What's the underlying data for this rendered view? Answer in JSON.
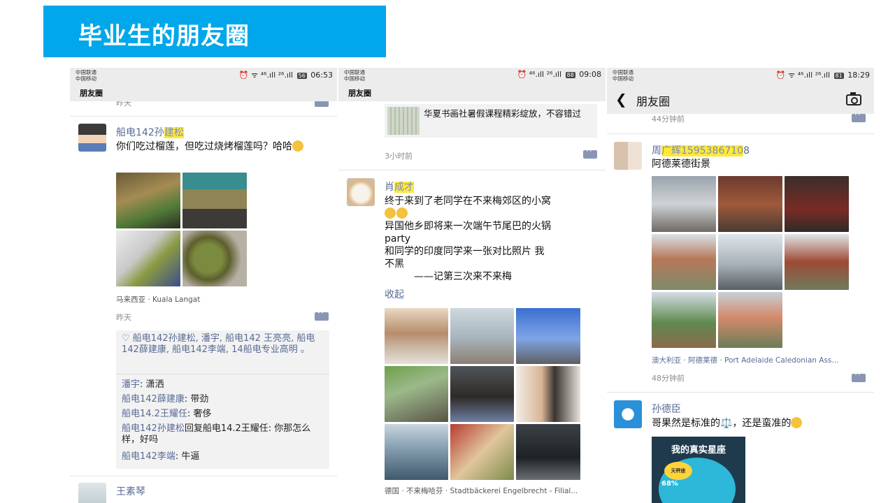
{
  "slide": {
    "title": "毕业生的朋友圈"
  },
  "phone1": {
    "status": {
      "carrier1": "中国联通",
      "carrier2": "中国移动",
      "signal": "⏰ ᯤ ⁴⁶.ıll ²⁶.ıll",
      "battery": "56",
      "time": "06:53"
    },
    "nav_title": "朋友圈",
    "prev_time": "昨天",
    "post": {
      "name_prefix": "船电142孙",
      "name_hl": "建松",
      "text": "你们吃过榴莲，但吃过烧烤榴莲吗？哈哈",
      "location": "马来西亚 · Kuala Langat",
      "time": "昨天",
      "likes": "♡ 船电142孙建松, 潘宇, 船电142 王亮亮, 船电142薛建康, 船电142李端, 14船电专业高明 。",
      "comments": [
        {
          "name": "潘宇",
          "text": ": 潇洒"
        },
        {
          "name": "船电142薛建康",
          "text": ": 带劲"
        },
        {
          "name": "船电14.2王耀任",
          "text": ": 奢侈"
        },
        {
          "name": "船电142孙建松",
          "text": "回复船电14.2王耀任: 你那怎么样，好吗"
        },
        {
          "name": "船电142李端",
          "text": ": 牛逼"
        }
      ]
    },
    "next_name": "王素琴"
  },
  "phone2": {
    "status": {
      "carrier1": "中国联通",
      "carrier2": "中国移动",
      "signal": "⏰ ⁴⁶.ıll ²⁶.ıll",
      "battery": "88",
      "time": "09:08"
    },
    "nav_title": "朋友圈",
    "link_text": "华夏书画社暑假课程精彩绽放，不容错过",
    "link_time": "3小时前",
    "post": {
      "name_prefix": "肖",
      "name_hl": "成才",
      "lines": [
        "终于来到了老同学在不来梅郊区的小窝",
        "异国他乡即将来一次端午节尾巴的火锅",
        "party",
        "和同学的印度同学来一张对比照片  我",
        "不黑",
        "——记第三次来不来梅"
      ],
      "collapse": "收起",
      "location": "德国 · 不来梅哈芬 · Stadtbäckerei Engelbrecht - Filial..."
    }
  },
  "phone3": {
    "status": {
      "carrier1": "中国联通",
      "carrier2": "中国移动",
      "signal": "⏰ ᯤ ⁴⁶.ıll ²⁶.ıll",
      "battery": "81",
      "time": "18:29"
    },
    "nav_title": "朋友圈",
    "prev_time": "44分钟前",
    "post": {
      "name_prefix": "周",
      "name_hl": "广辉1595386710",
      "name_suffix": "8",
      "text": "阿德莱德街景",
      "location": "澳大利亚 · 阿德莱德 · Port Adelaide Caledonian Ass...",
      "time": "48分钟前"
    },
    "post2": {
      "name": "孙德臣",
      "text": "哥果然是标准的⚖️，还是蛮准的",
      "card_title": "我的真实星座",
      "card_badge": "天秤座",
      "card_pct": "68%"
    }
  },
  "colors": {
    "banner": "#00a7ea",
    "link_blue": "#576b95",
    "highlight": "#ffe83a"
  }
}
